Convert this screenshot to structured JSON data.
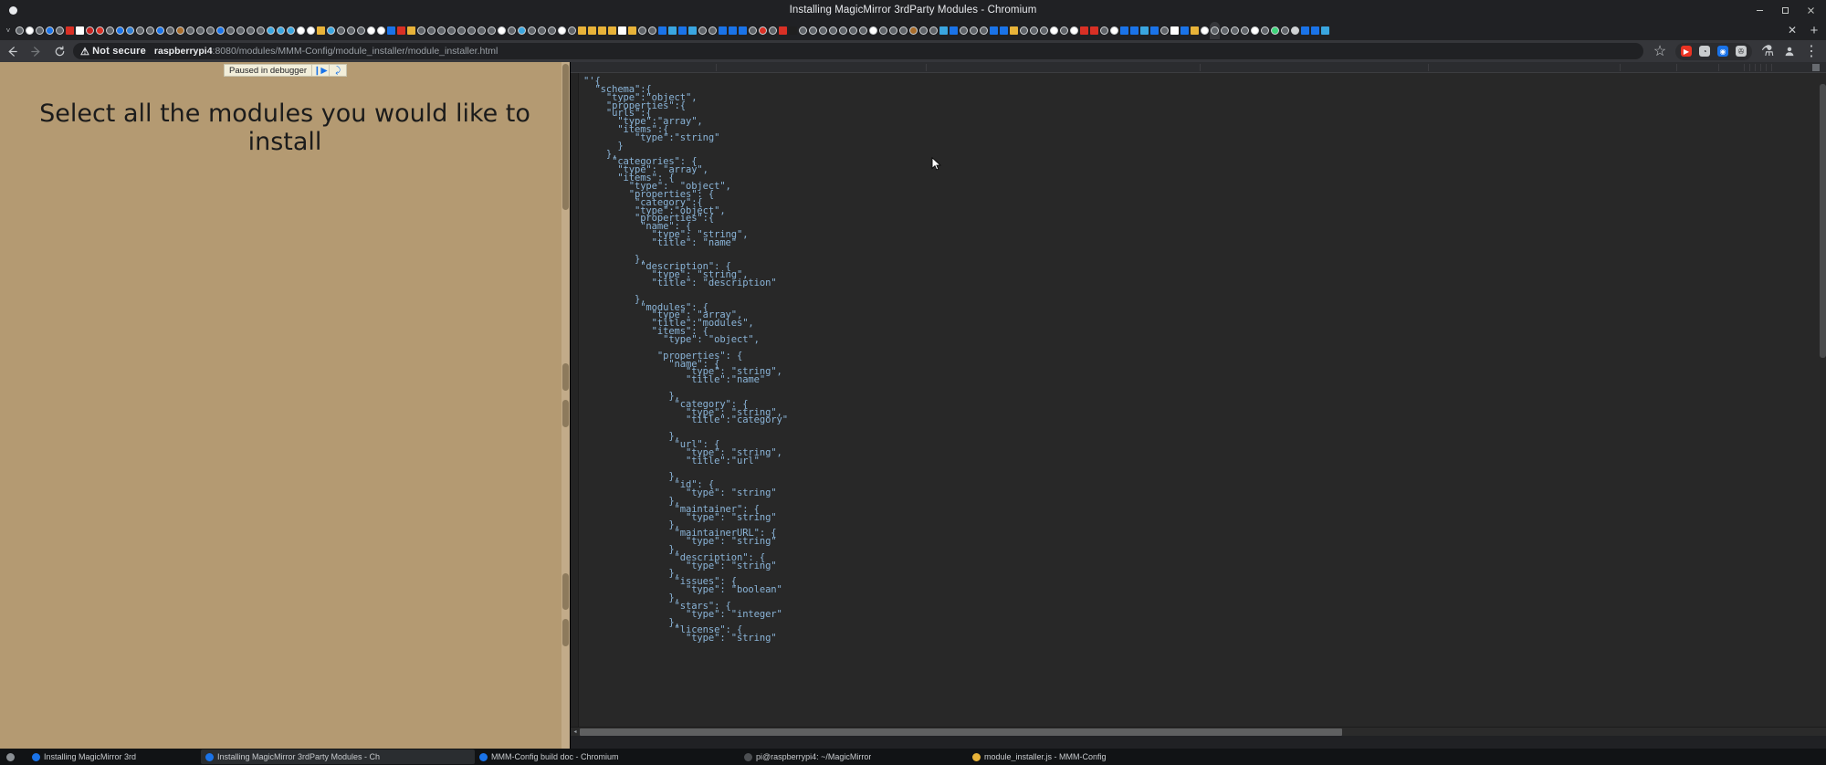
{
  "window": {
    "title": "Installing MagicMirror 3rdParty Modules - Chromium",
    "controls": [
      {
        "name": "minimize-button",
        "glyph": "–"
      },
      {
        "name": "maximize-button",
        "glyph": "□"
      },
      {
        "name": "close-button",
        "glyph": "✕"
      }
    ]
  },
  "tabstrip": {
    "overflow_chevron": "˅",
    "close_label": "✕",
    "new_tab_label": "+",
    "tab_count": 131,
    "active_tab_index": 119
  },
  "toolbar": {
    "back_label": "←",
    "forward_label": "→",
    "reload_label": "⟳",
    "security_warning_icon": "⚠",
    "security_warning_text": "Not secure",
    "url_host": "raspberrypi4",
    "url_path": ":8080/modules/MMM-Config/module_installer/module_installer.html",
    "bookmark_label": "☆",
    "extensions": [
      {
        "name": "youtube-extension-icon",
        "color": "#ea3323",
        "glyph": "▶"
      },
      {
        "name": "pie-extension-icon",
        "color": "#c9ccce",
        "glyph": "◔"
      },
      {
        "name": "eye-extension-icon",
        "color": "#1a73e8",
        "glyph": "◉"
      },
      {
        "name": "clipboard-extension-icon",
        "color": "#c9ccce",
        "glyph": "✇"
      }
    ],
    "lab_icon": "⚗",
    "profile_icon": "●",
    "menu_icon": "⋮"
  },
  "page": {
    "heading": "Select all the modules you would like to install",
    "background_color": "#b49a72",
    "debugger_banner": {
      "text": "Paused in debugger",
      "resume_label": "❙▶",
      "step_label": "⤸"
    }
  },
  "devtools": {
    "code": "\"'{\n  \"schema\":{\n    \"type\":\"object\",\n    \"properties\":{\n    \"urls\":{\n      \"type\":\"array\",\n      \"items\":{\n         \"type\":\"string\"\n      }\n    },\n     \"categories\": {\n      \"type\": \"array\",\n      \"items\": {\n        \"type\":  \"object\",\n        \"properties\": {\n         \"category\":{\n         \"type\":\"object\",\n         \"properties\":{\n          \"name\": {\n            \"type\": \"string\",\n            \"title\": \"name\"\n\n         },\n          \"description\": {\n            \"type\": \"string\",\n            \"title\": \"description\"\n\n         },\n          \"modules\": {\n            \"type\": \"array\",\n            \"title\":\"modules\",\n            \"items\": {\n              \"type\": \"object\",\n\n             \"properties\": {\n               \"name\": {\n                  \"type\": \"string\",\n                  \"title\":\"name\"\n\n               },\n                \"category\": {\n                  \"type\": \"string\",\n                  \"title\":\"category\"\n\n               },\n                \"url\": {\n                  \"type\": \"string\",\n                  \"title\":\"url\"\n\n               },\n                \"id\": {\n                  \"type\": \"string\"\n               },\n                \"maintainer\": {\n                  \"type\": \"string\"\n               },\n                \"maintainerURL\": {\n                  \"type\": \"string\"\n               },\n                \"description\": {\n                  \"type\": \"string\"\n               },\n                \"issues\": {\n                  \"type\": \"boolean\"\n               },\n                \"stars\": {\n                  \"type\": \"integer\"\n               },\n                \"license\": {\n                  \"type\": \"string\"",
    "scroll_left_arrow": "◂",
    "scroll_right_arrow": "▸"
  },
  "taskbar": {
    "items": [
      {
        "name": "taskbar-item-files",
        "label": "",
        "color": "#8a8f94"
      },
      {
        "name": "taskbar-item-browser-1",
        "label": "Installing MagicMirror 3rd",
        "color": "#1a73e8"
      },
      {
        "name": "taskbar-item-browser-2",
        "label": "Installing MagicMirror 3rdParty Modules - Ch",
        "color": "#1a73e8"
      },
      {
        "name": "taskbar-item-browser-3",
        "label": "MMM-Config build doc - Chromium",
        "color": "#1a73e8"
      },
      {
        "name": "taskbar-item-terminal",
        "label": "pi@raspberrypi4: ~/MagicMirror",
        "color": "#4c4f52"
      },
      {
        "name": "taskbar-item-editor",
        "label": "module_installer.js - MMM-Config",
        "color": "#e8b339"
      }
    ]
  }
}
